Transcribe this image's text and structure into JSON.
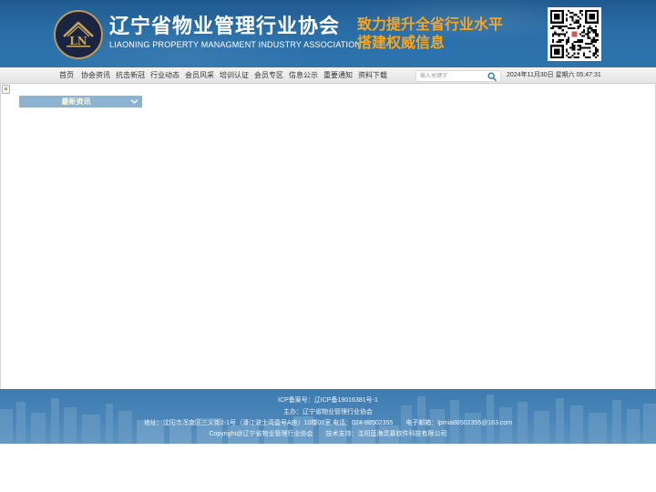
{
  "header": {
    "logo_cn": "辽宁省物业管理行业协会",
    "logo_en": "LIAONING PROPERTY MANAGMENT INDUSTRY ASSOCIATION",
    "logo_badge_text": "LN",
    "slogan_line1": "致力提升全省行业水平",
    "slogan_line2": "搭建权威信息",
    "logo_icon": "association-logo-icon",
    "qr_icon": "qr-code-icon"
  },
  "nav": {
    "items": [
      {
        "label": "首页"
      },
      {
        "label": "协会资讯"
      },
      {
        "label": "抗击新冠"
      },
      {
        "label": "行业动态"
      },
      {
        "label": "会员风采"
      },
      {
        "label": "培训认证"
      },
      {
        "label": "会员专区"
      },
      {
        "label": "信息公示"
      },
      {
        "label": "重要通知"
      },
      {
        "label": "资料下载"
      }
    ],
    "search_placeholder": "输入关键字",
    "search_icon": "search-icon",
    "datetime": "2024年11月30日 星期六 05:47:31"
  },
  "main": {
    "news_title": "最新资讯",
    "news_icon": "chevron-down-icon"
  },
  "footer": {
    "icp": "ICP备案号：辽ICP备19016381号-1",
    "sponsor": "主办：辽宁省物业管理行业协会",
    "address": "地址：沈阳市浑南区三义街2-1号（潘江波士湾壹号A座）10楼08室",
    "phone": "电话：024-88502355",
    "email": "电子邮箱：lpmia88502355@163.com",
    "copyright": "Copyright@辽宁省物业管理行业协会",
    "tech_support": "技术支持：沈阳蓝海灵慕软件科技有限公司"
  },
  "colors": {
    "banner": "#2a6ea7",
    "slogan": "#f5a623",
    "news_header": "#8db3d1",
    "footer": "#4a86b8"
  }
}
